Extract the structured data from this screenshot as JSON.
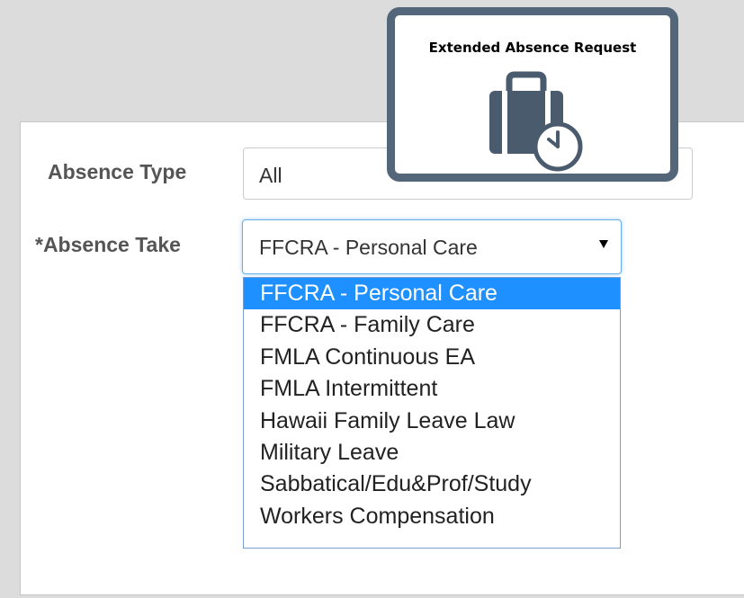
{
  "badge": {
    "title": "Extended Absence Request",
    "icon": "briefcase-clock-icon",
    "border_color": "#53667a"
  },
  "form": {
    "absence_type": {
      "label": "Absence Type",
      "value": "All"
    },
    "absence_take": {
      "label": "*Absence Take",
      "value": "FFCRA - Personal Care",
      "options": [
        "FFCRA - Personal Care",
        "FFCRA - Family Care",
        "FMLA Continuous EA",
        "FMLA Intermittent",
        "Hawaii Family Leave Law",
        "Military Leave",
        "Sabbatical/Edu&Prof/Study",
        "Workers Compensation"
      ],
      "highlighted_index": 0,
      "highlight_color": "#1e90ff"
    }
  }
}
